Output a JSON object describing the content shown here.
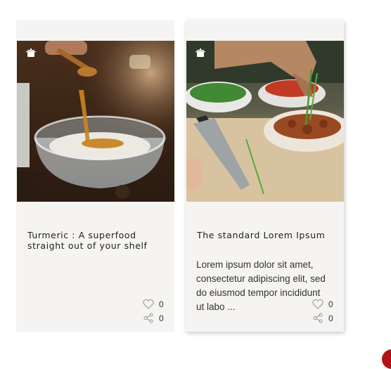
{
  "cards": [
    {
      "title": "Turmeric : A superfood straight out of your shelf",
      "excerpt": "",
      "likes": "0",
      "shares": "0",
      "category_icon": "cooking-pot-icon"
    },
    {
      "title": "The standard Lorem Ipsum",
      "excerpt": "Lorem ipsum dolor sit amet, consectetur adipiscing elit, sed do eiusmod tempor incididunt ut labo ...",
      "likes": "0",
      "shares": "0",
      "category_icon": "cooking-pot-icon"
    }
  ],
  "colors": {
    "card_background": "#f5f4f2",
    "accent": "#b3121a",
    "text": "#222222"
  }
}
